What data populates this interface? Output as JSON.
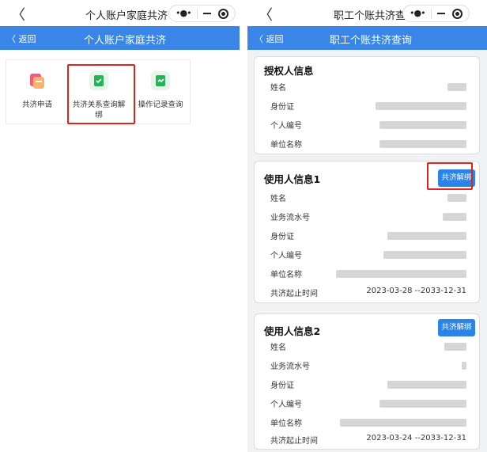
{
  "left": {
    "window_title": "个人账户家庭共济",
    "nav_back": "〈 返回",
    "nav_title": "个人账户家庭共济",
    "menu": [
      {
        "label": "共济申请",
        "icon": "apply-icon"
      },
      {
        "label": "共济关系查询解绑",
        "icon": "query-unbind-icon"
      },
      {
        "label": "操作记录查询",
        "icon": "record-icon"
      }
    ]
  },
  "right": {
    "window_title": "职工个账共济查询",
    "nav_back": "〈 返回",
    "nav_title": "职工个账共济查询",
    "authorizer": {
      "title": "授权人信息",
      "fields": [
        "姓名",
        "身份证",
        "个人编号",
        "单位名称"
      ]
    },
    "user1": {
      "title": "使用人信息1",
      "button": "共济解绑",
      "fields": [
        "姓名",
        "业务流水号",
        "身份证",
        "个人编号",
        "单位名称",
        "共济起止时间"
      ],
      "period": "2023-03-28 --2033-12-31"
    },
    "user2": {
      "title": "使用人信息2",
      "button": "共济解绑",
      "fields": [
        "姓名",
        "业务流水号",
        "身份证",
        "个人编号",
        "单位名称",
        "共济起止时间"
      ],
      "period": "2023-03-24 --2033-12-31"
    }
  },
  "colors": {
    "nav": "#3a86e8",
    "button": "#2a83e6",
    "highlight": "#e0231e"
  }
}
